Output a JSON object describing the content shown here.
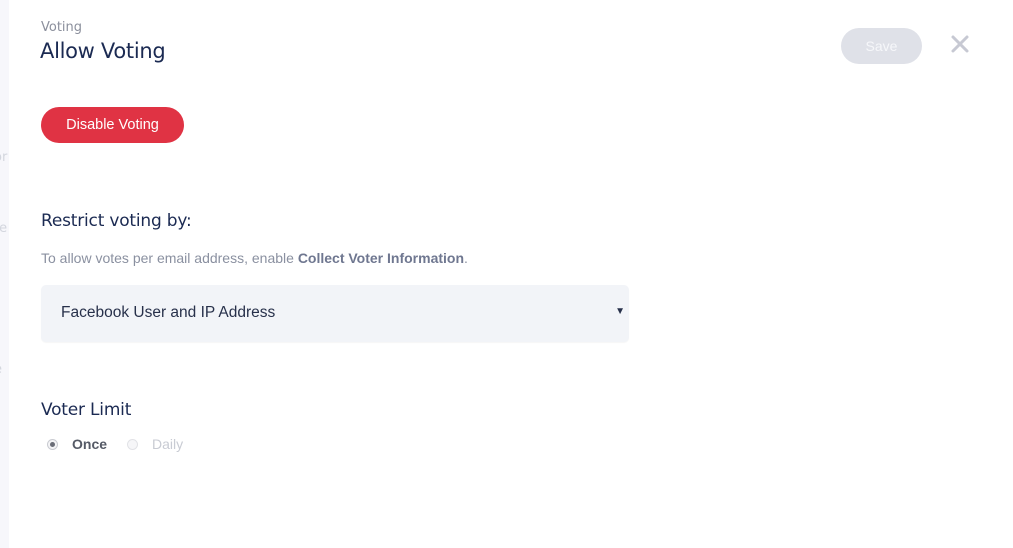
{
  "background_fragments": [
    "or",
    "te",
    "e"
  ],
  "header": {
    "eyebrow": "Voting",
    "title": "Allow Voting",
    "save_label": "Save",
    "close_icon": "close-icon"
  },
  "disable_button": {
    "label": "Disable Voting",
    "color": "#e03344"
  },
  "restrict": {
    "title": "Restrict voting by:",
    "hint_prefix": "To allow votes per email address, enable ",
    "hint_link": "Collect Voter Information",
    "hint_suffix": ".",
    "select_value": "Facebook User and IP Address",
    "caret": "▼"
  },
  "voter_limit": {
    "title": "Voter Limit",
    "options": [
      {
        "label": "Once",
        "checked": true,
        "disabled": false
      },
      {
        "label": "Daily",
        "checked": false,
        "disabled": true
      }
    ]
  }
}
